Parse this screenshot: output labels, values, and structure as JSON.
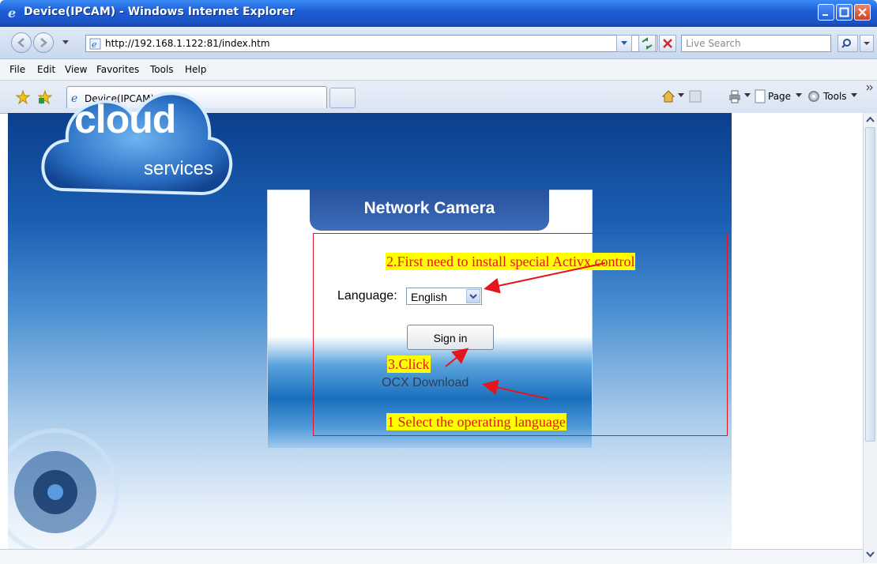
{
  "window": {
    "title": "Device(IPCAM) - Windows Internet Explorer",
    "controls": [
      "minimize-icon",
      "maximize-icon",
      "close-icon"
    ]
  },
  "address_bar": {
    "url": "http://192.168.1.122:81/index.htm",
    "search_placeholder": "Live Search"
  },
  "menu": {
    "items": [
      "File",
      "Edit",
      "View",
      "Favorites",
      "Tools",
      "Help"
    ]
  },
  "tabs": {
    "active_tab_label": "Device(IPCAM)"
  },
  "command_bar": {
    "page_label": "Page",
    "tools_label": "Tools"
  },
  "page": {
    "logo_word": "cloud",
    "logo_sub": "services",
    "panel_title": "Network Camera",
    "language_label": "Language:",
    "language_selected": "English",
    "signin_label": "Sign in",
    "ocx_link": "OCX Download"
  },
  "annotations": {
    "note_activex": "2.First need to install special Activx control",
    "note_click": "3.Click",
    "note_language": "1 Select the operating language"
  },
  "colors": {
    "annotation_red": "#e5151d",
    "highlight_yellow": "#ffff00",
    "titlebar_blue": "#1f5fd6"
  }
}
